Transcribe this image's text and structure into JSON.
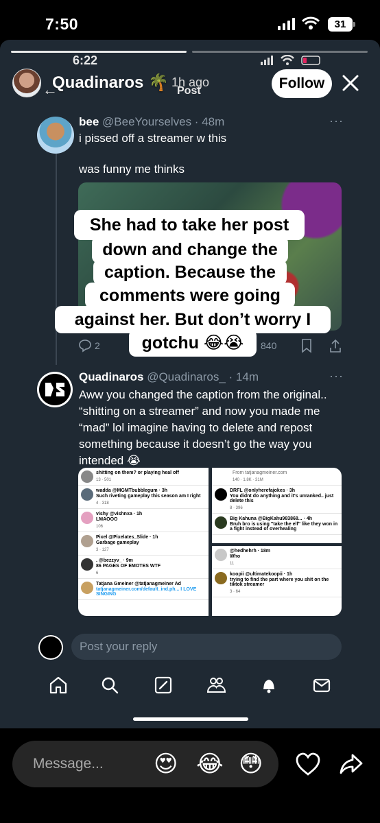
{
  "status": {
    "time": "7:50",
    "battery": "31"
  },
  "inner_status": {
    "time": "6:22"
  },
  "story": {
    "username": "Quadinaros",
    "emoji": "🌴",
    "time": "1h ago",
    "follow_label": "Follow",
    "header_title": "Post"
  },
  "tweet1": {
    "name": "bee",
    "handle": "@BeeYourselves · 48m",
    "text_line1": "i pissed off a streamer w this",
    "text_line2": "was funny me thinks",
    "reply_count": "2",
    "view_count": "840"
  },
  "caption": {
    "line1": "She had to take her post",
    "line2": "down and change the",
    "line3": "caption. Because the",
    "line4": "comments were going",
    "line5": "against her. But don’t worry I",
    "line6": "gotchu 😂😭"
  },
  "tweet2": {
    "name": "Quadinaros",
    "handle": "@Quadinaros_ · 14m",
    "line1": "Aww you changed the caption from the original..",
    "line2": "“shitting on a streamer” and now you made me",
    "line3": "“mad” lol imagine having to delete and repost",
    "line4": "something because it doesn’t go the way you",
    "line5": "intended 😭"
  },
  "collage": {
    "left": [
      {
        "head": "shitting on them? or playing heal off",
        "body": "",
        "acts": "13 · 501"
      },
      {
        "head": "wadda @MGMTbubblegum · 3h",
        "body": "Such riveting gameplay this season am I right",
        "acts": "4 · 318"
      },
      {
        "head": "vishy @vishnxa · 1h",
        "body": "LMAOOO",
        "acts": "106"
      },
      {
        "head": "Pixel @Pixelates_Slide · 1h",
        "body": "Garbage gameplay",
        "acts": "3 · 127"
      },
      {
        "head": ". @bezzyv_ · 9m",
        "body": "86 PAGES OF EMOTES WTF",
        "acts": "6"
      },
      {
        "head": "Tatjana Gmeiner @tatjanagmeiner  Ad",
        "body": "tatjanagmeiner.com/default_ind.ph... I LOVE SINGING",
        "acts": ""
      }
    ],
    "right": [
      {
        "head": "From tatjanagmeiner.com",
        "body": "",
        "acts": "140 · 1.8K · 31M"
      },
      {
        "head": "DRFL @onlyherefajokes · 3h",
        "body": "You didnt do anything and it's unranked.. just delete this",
        "acts": "8 · 396"
      },
      {
        "head": "Big Kahuna @BigKahu983868... · 4h",
        "body": "Bruh bro is using \"take the elf\" like they won in a fight instead of overhealing",
        "acts": ""
      },
      {
        "head": "@hedhehrh · 18m",
        "body": "Who",
        "acts": "11"
      },
      {
        "head": "koopii @ultimatekoopii · 1h",
        "body": "trying to find the part where you shit on the tiktok streamer",
        "acts": "3 · 64"
      }
    ]
  },
  "reply": {
    "placeholder": "Post your reply"
  },
  "message": {
    "placeholder": "Message...",
    "emoji1": "😍",
    "emoji2": "😂",
    "emoji3": "😳"
  },
  "icons": [
    "signal-icon",
    "wifi-icon",
    "battery-icon",
    "close-icon",
    "back-arrow-icon",
    "more-dots-icon",
    "reply-icon",
    "bookmark-icon",
    "share-icon",
    "home-icon",
    "search-icon",
    "compose-icon",
    "communities-icon",
    "notifications-icon",
    "messages-icon",
    "heart-icon",
    "send-icon"
  ]
}
